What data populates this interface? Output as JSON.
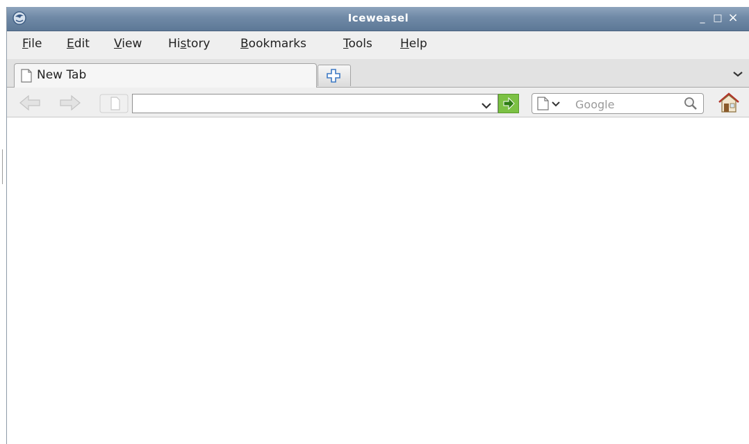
{
  "window": {
    "title": "Iceweasel",
    "controls": {
      "minimize": "_",
      "maximize": "□",
      "close": "×"
    }
  },
  "menubar": {
    "items": [
      {
        "label": "File",
        "mnemonic_index": 0
      },
      {
        "label": "Edit",
        "mnemonic_index": 0
      },
      {
        "label": "View",
        "mnemonic_index": 0
      },
      {
        "label": "History",
        "mnemonic_index": 2
      },
      {
        "label": "Bookmarks",
        "mnemonic_index": 0
      },
      {
        "label": "Tools",
        "mnemonic_index": 0
      },
      {
        "label": "Help",
        "mnemonic_index": 0
      }
    ]
  },
  "tabs": {
    "items": [
      {
        "label": "New Tab",
        "active": true,
        "icon": "document-icon"
      }
    ]
  },
  "navbar": {
    "url": {
      "value": "",
      "placeholder": ""
    },
    "search": {
      "engine": "Google",
      "placeholder": "Google",
      "value": ""
    }
  },
  "icons": {
    "back": "back-arrow-icon",
    "forward": "forward-arrow-icon",
    "page": "page-icon",
    "go": "go-arrow-icon",
    "search": "magnifier-icon",
    "home": "home-icon",
    "new_tab": "plus-icon",
    "tab_list": "chevron-down-icon"
  },
  "colors": {
    "titlebar": "#6f89a6",
    "go_button": "#7cc144",
    "chrome": "#efefef"
  }
}
